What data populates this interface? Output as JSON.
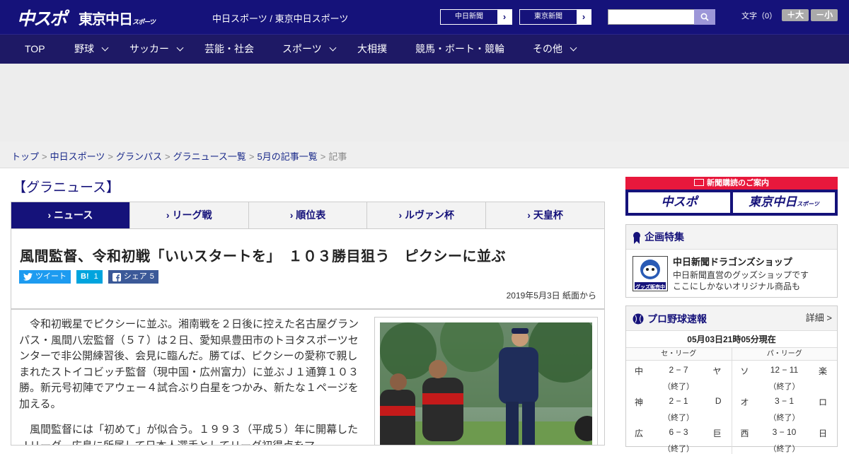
{
  "header": {
    "logo_main": "中スポ",
    "logo_tokyo": "東京中日",
    "logo_tokyo_small": "スポーツ",
    "site_name": "中日スポーツ / 東京中日スポーツ",
    "link1": "中日新聞",
    "link2": "東京新聞",
    "search_placeholder": "",
    "font_label": "文字（0）",
    "font_up": "＋大",
    "font_down": "－小"
  },
  "nav": {
    "items": [
      {
        "label": "TOP"
      },
      {
        "label": "野球"
      },
      {
        "label": "サッカー"
      },
      {
        "label": "芸能・社会"
      },
      {
        "label": "スポーツ"
      },
      {
        "label": "大相撲"
      },
      {
        "label": "競馬・ボート・競輪"
      },
      {
        "label": "その他"
      }
    ]
  },
  "breadcrumb": {
    "items": [
      "トップ",
      "中日スポーツ",
      "グランパス",
      "グラニュース一覧",
      "5月の記事一覧"
    ],
    "current": "記事",
    "sep": ">"
  },
  "section_title": "【グラニュース】",
  "tabs": [
    {
      "label": "ニュース"
    },
    {
      "label": "リーグ戦"
    },
    {
      "label": "順位表"
    },
    {
      "label": "ルヴァン杯"
    },
    {
      "label": "天皇杯"
    }
  ],
  "article": {
    "headline": "風間監督、令和初戦「いいスタートを」　１０３勝目狙う　ピクシーに並ぶ",
    "tweet_label": "ツイート",
    "hatena_label": "B!",
    "hatena_count": "1",
    "share_label": "シェア",
    "share_count": "5",
    "date": "2019年5月3日 紙面から",
    "para1": "令和初戦星でピクシーに並ぶ。湘南戦を２日後に控えた名古屋グランパス・風間八宏監督（５７）は２日、愛知県豊田市のトヨタスポーツセンターで非公開練習後、会見に臨んだ。勝てば、ピクシーの愛称で親しまれたストイコビッチ監督（現中国・広州富力）に並ぶＪ１通算１０３勝。新元号初陣でアウェー４試合ぶり白星をつかみ、新たな１ページを加える。",
    "para2": "風間監督には「初めて」が似合う。１９９３（平成５）年に開幕したＪリーグ、広島に所属して日本人選手としてリーグ初得点をマ"
  },
  "sidebar": {
    "sub_banner": "新聞購読のご案内",
    "sub_logo1": "中スポ",
    "sub_logo2": "東京中日",
    "sub_logo2_small": "スポーツ",
    "feature_head": "企画特集",
    "feature_title": "中日新聞ドラゴンズショップ",
    "feature_desc1": "中日新聞直営のグッズショップです",
    "feature_desc2": "ここにしかないオリジナル商品も",
    "feature_thumb_label": "グッズ販売中",
    "baseball_title": "プロ野球速報",
    "baseball_more": "詳細 >",
    "baseball_time": "05月03日21時05分現在",
    "central_name": "セ・リーグ",
    "pacific_name": "パ・リーグ",
    "central_games": [
      {
        "t1": "中",
        "score": "2 − 7",
        "t2": "ヤ",
        "status": "（終了）"
      },
      {
        "t1": "神",
        "score": "2 − 1",
        "t2": "D",
        "status": "（終了）"
      },
      {
        "t1": "広",
        "score": "6 − 3",
        "t2": "巨",
        "status": "（終了）"
      }
    ],
    "pacific_games": [
      {
        "t1": "ソ",
        "score": "12 − 11",
        "t2": "楽",
        "status": "（終了）"
      },
      {
        "t1": "オ",
        "score": "3 − 1",
        "t2": "ロ",
        "status": "（終了）"
      },
      {
        "t1": "西",
        "score": "3 − 10",
        "t2": "日",
        "status": "（終了）"
      }
    ]
  },
  "colors": {
    "brand_navy": "#15127a",
    "nav_navy": "#1e1965",
    "subscribe_red": "#e8183c",
    "twitter": "#1d9bf0",
    "hatena": "#00a4de",
    "facebook": "#3b5998"
  }
}
